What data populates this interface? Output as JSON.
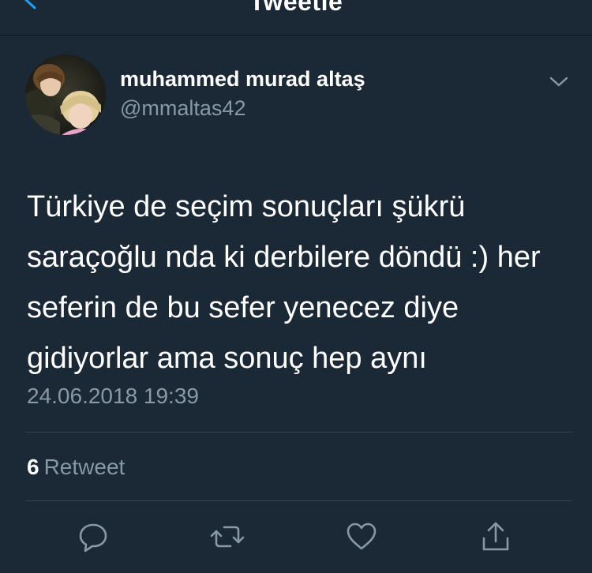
{
  "nav": {
    "title": "Tweetle",
    "back_icon": "chevron-left-icon"
  },
  "tweet": {
    "author": {
      "display_name": "muhammed murad altaş",
      "handle": "@mmaltas42",
      "avatar": "avatar-photo"
    },
    "text": "Türkiye de seçim sonuçları şükrü saraçoğlu nda ki derbilere döndü :) her seferin de bu sefer yenecez diye gidiyorlar ama sonuç hep aynı",
    "timestamp": "24.06.2018 19:39",
    "stats": {
      "retweet_count": "6",
      "retweet_label": "Retweet"
    },
    "actions": [
      "reply-icon",
      "retweet-icon",
      "like-icon",
      "share-icon"
    ]
  },
  "colors": {
    "background": "#1b2836",
    "text_primary": "#ffffff",
    "text_secondary": "#8899a6",
    "divider": "#38444d",
    "accent": "#1da1f2"
  }
}
